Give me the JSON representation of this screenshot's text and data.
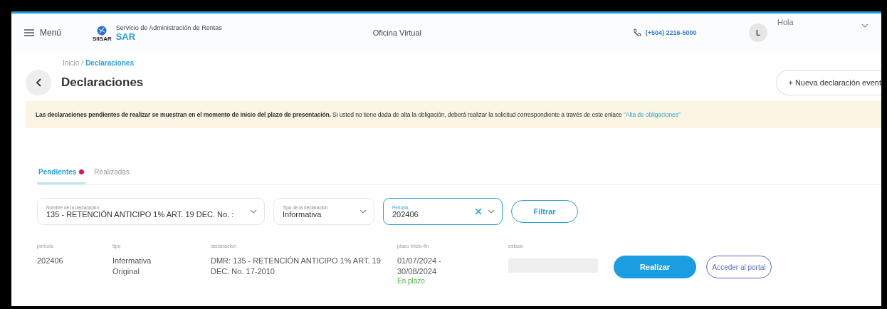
{
  "header": {
    "menu_label": "Menú",
    "logo_caption": "SIISAR",
    "org_name": "Servicio de Administración de Rentas",
    "org_short": "SAR",
    "center_title": "Oficina Virtual",
    "phone": "(+504) 2216-5000",
    "avatar_initial": "L",
    "greeting": "Hola"
  },
  "breadcrumb_separator": "/",
  "breadcrumb": [
    {
      "label": "Inicio",
      "current": false
    },
    {
      "label": "Declaraciones",
      "current": true
    }
  ],
  "page_title": "Declaraciones",
  "new_button": "+ Nueva declaración event",
  "banner": {
    "text": "**Las declaraciones pendientes de realizar se muestran en el momento de inicio del plazo de presentación.** Si usted no tiene dada de alta la obligación, deberá realizar la solicitud correspondiente a través de este enlace",
    "link": "\"Alta de obligaciones\""
  },
  "tabs": [
    {
      "label": "Pendientes",
      "selected": true,
      "dot": true
    },
    {
      "label": "Realizadas",
      "selected": false,
      "dot": false
    }
  ],
  "filters": [
    {
      "kind": "select",
      "label": "Nombre de la declaración",
      "value": "135 - RETENCIÓN ANTICIPO 1% ART. 19 DEC. No. :",
      "focused": false
    },
    {
      "kind": "select",
      "label": "Tipo de la declaración",
      "value": "Informativa",
      "focused": false
    },
    {
      "kind": "input",
      "label": "Periodo",
      "value": "202406",
      "focused": true
    }
  ],
  "filter_button": "Filtrar",
  "table": {
    "columns": [
      "periodo",
      "tipo",
      "declaracion",
      "plazo inicio-fin",
      "estado"
    ],
    "rows": [
      {
        "periodo": "202406",
        "tipo": [
          "Informativa",
          "Original"
        ],
        "declaracion": "DMR: 135 - RETENCIÓN ANTICIPO 1% ART. 19 DEC. No. 17-2010",
        "plazo": [
          "01/07/2024 -",
          "30/08/2024"
        ],
        "plazo_status": "En plazo",
        "actions": [
          "Realizar",
          "Acceder al portal"
        ]
      }
    ]
  }
}
